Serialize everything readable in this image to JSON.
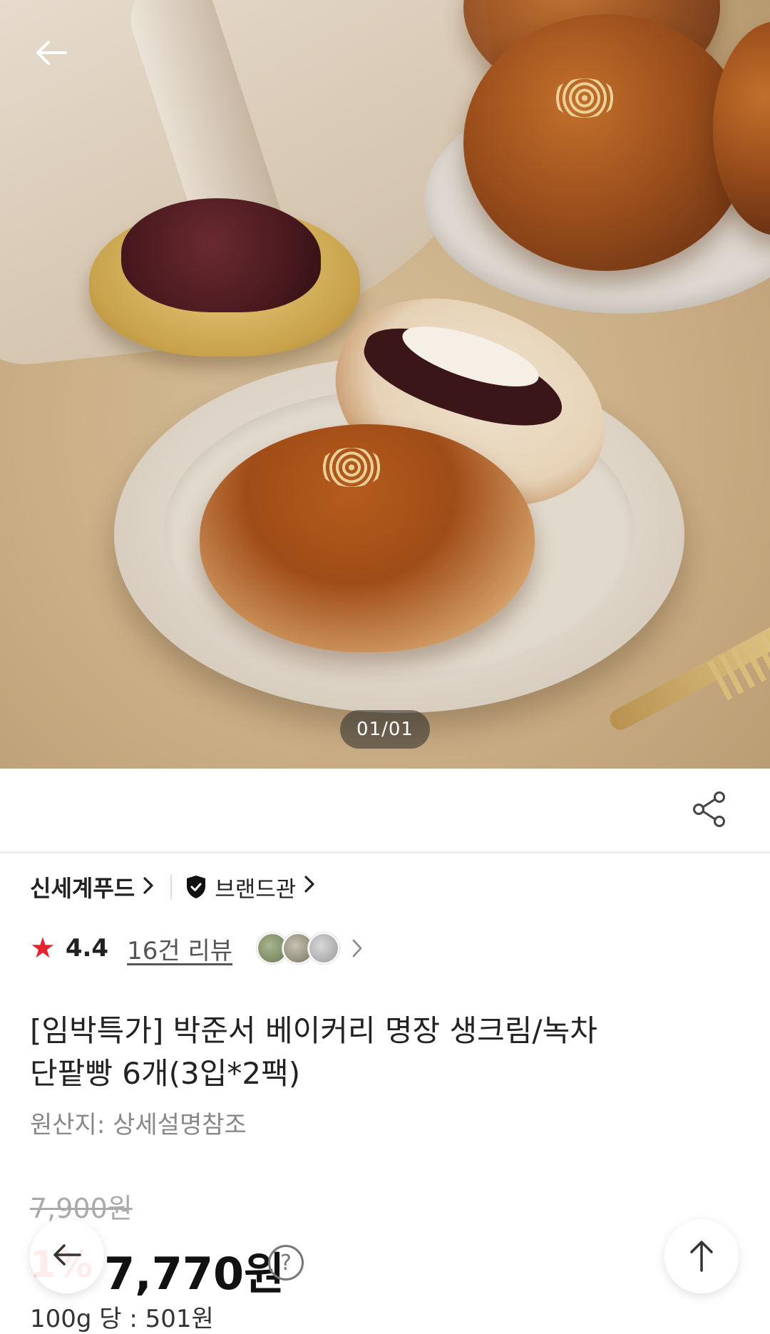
{
  "hero": {
    "image_counter": "01/01"
  },
  "brand": {
    "seller_name": "신세계푸드",
    "brand_hall_label": "브랜드관"
  },
  "rating": {
    "score": "4.4",
    "reviews_label": "16건 리뷰"
  },
  "product": {
    "title_line1": "[임박특가] 박준서 베이커리 명장 생크림/녹차",
    "title_line2": "단팥빵 6개(3입*2팩)",
    "origin": "원산지: 상세설명참조"
  },
  "price": {
    "original": "7,900원",
    "discount": "1%",
    "final": "7,770원",
    "help_symbol": "?",
    "unit_price": "100g 당 : 501원"
  },
  "icons": {
    "back": "arrow-left-icon",
    "share": "share-icon",
    "shield": "shield-check-icon",
    "star": "star-icon",
    "scroll_top": "arrow-up-icon"
  },
  "colors": {
    "star": "#e5232d",
    "discount": "#ff4b43"
  }
}
